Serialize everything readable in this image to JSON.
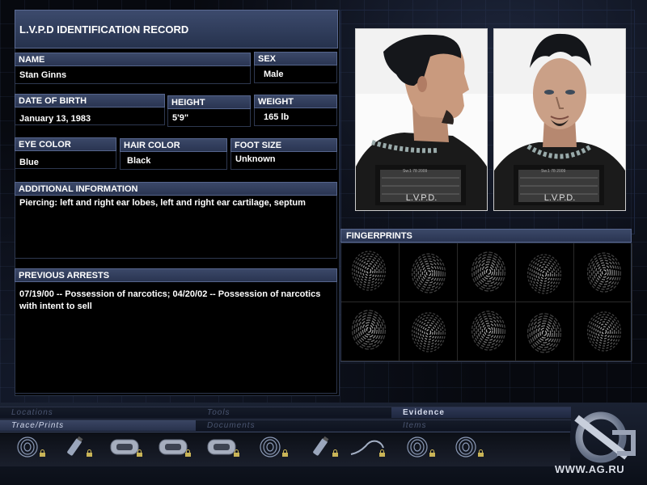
{
  "record": {
    "title": "L.V.P.D IDENTIFICATION RECORD",
    "fields": {
      "name": {
        "label": "NAME",
        "value": "Stan Ginns"
      },
      "sex": {
        "label": "SEX",
        "value": "Male"
      },
      "dob": {
        "label": "DATE OF BIRTH",
        "value": "January 13, 1983"
      },
      "height": {
        "label": "HEIGHT",
        "value": "5'9\""
      },
      "weight": {
        "label": "WEIGHT",
        "value": "165 lb"
      },
      "eye_color": {
        "label": "EYE COLOR",
        "value": "Blue"
      },
      "hair_color": {
        "label": "HAIR COLOR",
        "value": "Black"
      },
      "foot_size": {
        "label": "FOOT SIZE",
        "value": "Unknown"
      }
    },
    "additional": {
      "label": "ADDITIONAL INFORMATION",
      "value": "Piercing: left and right ear lobes, left and right ear cartilage, septum"
    },
    "arrests": {
      "label": "PREVIOUS ARRESTS",
      "value": "07/19/00 -- Possession of narcotics; 04/20/02 -- Possession of narcotics with intent to sell"
    }
  },
  "mugshots": {
    "placard_text": "L.V.P.D.",
    "placard_small": "Sw.1 78 2009"
  },
  "fingerprints": {
    "label": "FINGERPRINTS",
    "count": 10
  },
  "inventory": {
    "tabs": {
      "locations": "Locations",
      "tools": "Tools",
      "evidence": "Evidence",
      "trace_prints": "Trace/Prints",
      "documents": "Documents",
      "items": "Items"
    },
    "items": [
      "fingerprint-icon",
      "spray-bottle-icon",
      "tape-lift-icon",
      "tape-lift-icon",
      "tape-lift-icon",
      "fingerprint-icon",
      "spray-bottle-icon",
      "swab-wire-icon",
      "fingerprint-icon",
      "fingerprint-icon"
    ]
  },
  "watermark": "WWW.AG.RU",
  "colors": {
    "header_blue": "#3b4868",
    "header_border": "#56658c",
    "panel_bg": "#000000"
  }
}
